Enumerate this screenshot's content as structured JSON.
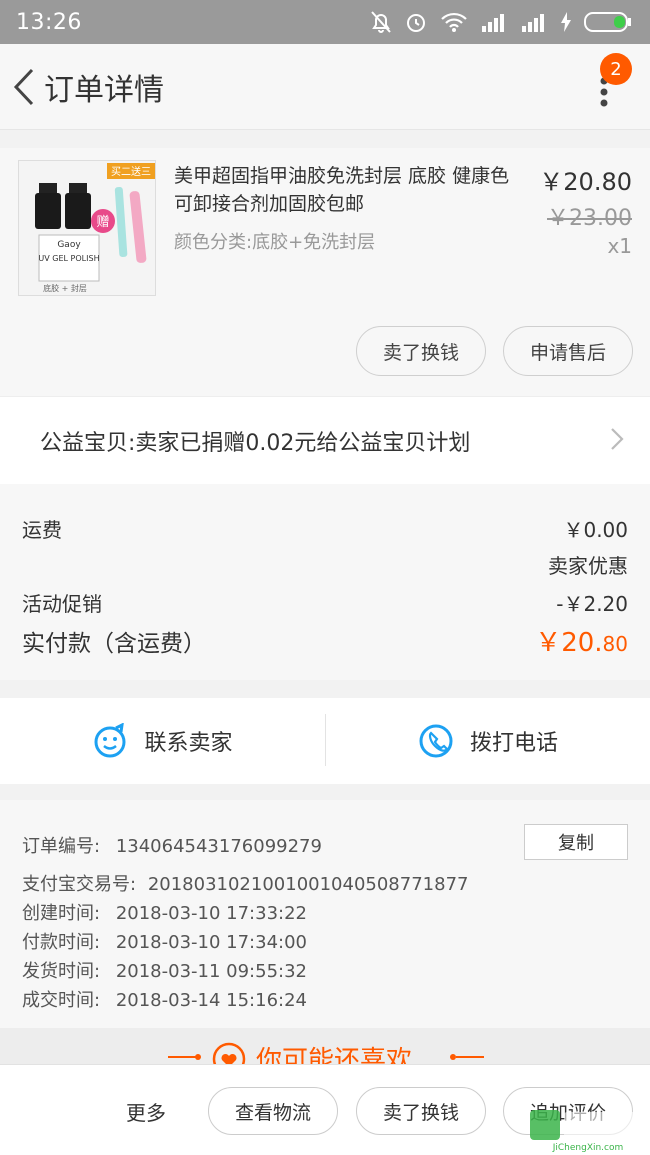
{
  "status_bar": {
    "time": "13:26"
  },
  "header": {
    "title": "订单详情",
    "badge_count": "2"
  },
  "product": {
    "title": "美甲超固指甲油胶免洗封层 底胶 健康色 可卸接合剂加固胶包邮",
    "sku": "颜色分类:底胶+免洗封层",
    "price": "￥20.80",
    "original_price": "￥23.00",
    "quantity": "x1",
    "image_texts": {
      "banner": "买二送三",
      "gift": "赠",
      "brand": "Gaoy",
      "polish": "UV GEL POLISH",
      "caption": "底胶 + 封层"
    },
    "actions": [
      "卖了换钱",
      "申请售后"
    ]
  },
  "charity": {
    "text": "公益宝贝:卖家已捐赠0.02元给公益宝贝计划"
  },
  "costs": {
    "shipping_label": "运费",
    "shipping_value": "￥0.00",
    "discount_note": "卖家优惠",
    "promo_label": "活动促销",
    "promo_value": "-￥2.20",
    "paid_label": "实付款（含运费）",
    "paid_main": "￥20.",
    "paid_decimal": "80"
  },
  "contact": {
    "seller": "联系卖家",
    "phone": "拨打电话"
  },
  "order_info": {
    "order_no_label": "订单编号:",
    "order_no": "134064543176099279",
    "copy_label": "复制",
    "alipay_label": "支付宝交易号:",
    "alipay_no": "2018031021001001040508771877",
    "created_label": "创建时间:",
    "created": "2018-03-10 17:33:22",
    "paid_label": "付款时间:",
    "paid": "2018-03-10 17:34:00",
    "shipped_label": "发货时间:",
    "shipped": "2018-03-11 09:55:32",
    "completed_label": "成交时间:",
    "completed": "2018-03-14 15:16:24"
  },
  "recommend": {
    "title": "你可能还喜欢"
  },
  "bottom_bar": {
    "more": "更多",
    "logistics": "查看物流",
    "sell": "卖了换钱",
    "review": "追加评价"
  },
  "watermark": {
    "text": "JiChengXin.com"
  },
  "colors": {
    "accent": "#ff5a00",
    "icon_blue": "#1da1f2"
  }
}
